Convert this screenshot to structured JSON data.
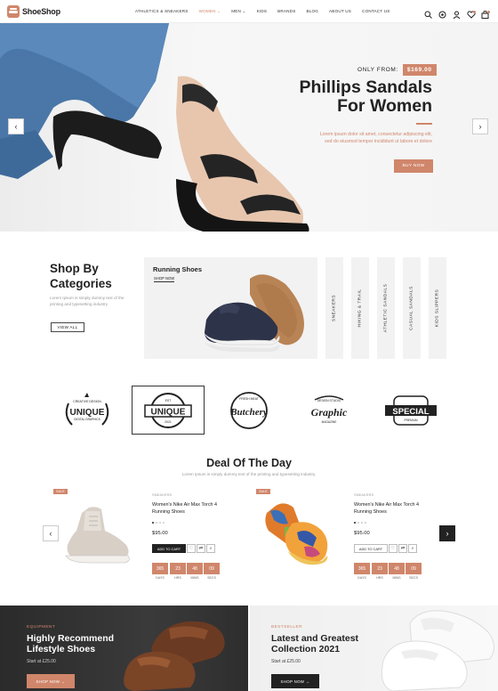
{
  "header": {
    "logo_text": "ShoeShop",
    "nav": [
      "ATHLETICS & SNEAKERS",
      "WOMEN ⌄",
      "MEN ⌄",
      "KIDS",
      "BRANDS",
      "BLOG",
      "ABOUT US",
      "CONTACT US"
    ],
    "active_nav": "WOMEN ⌄",
    "cart_count": "0",
    "wishlist_count": "0"
  },
  "hero": {
    "only_from": "ONLY FROM:",
    "price": "$169.00",
    "title_line1": "Phillips Sandals",
    "title_line2": "For Women",
    "desc_line1": "Lorem ipsum dolor sit amet, consectetur adipiscing elit,",
    "desc_line2": "sed do eiusmod tempor incididunt ut labore et dolore",
    "button": "BUY NOW",
    "prev": "‹",
    "next": "›"
  },
  "categories": {
    "title_line1": "Shop By",
    "title_line2": "Categories",
    "desc_line1": "Lorem Ipsum is simply dummy text of the",
    "desc_line2": "printing and typesetting industry.",
    "view_all": "VIEW ALL",
    "featured_title": "Running Shoes",
    "featured_link": "SHOP NOW",
    "vertical": [
      "SNEAKERS",
      "HIKING & TRAIL",
      "ATHLETIC SANDALS",
      "CASUAL SANDALS",
      "KIDS SLIPPERS"
    ]
  },
  "brands": {
    "items": [
      {
        "name": "UNIQUE",
        "sub": "CREATIVE DESIGN",
        "sub2": "DIGITAL GRAPHICS"
      },
      {
        "name": "UNIQUE",
        "sub": "EST",
        "sub2": "2021"
      },
      {
        "name": "Butchery",
        "sub": "FRESH MEAT",
        "sub2": ""
      },
      {
        "name": "Graphic",
        "sub": "DESIGN STUDIO",
        "sub2": "MAGAZINE"
      },
      {
        "name": "SPECIAL",
        "sub": "PREMIUM",
        "sub2": ""
      }
    ]
  },
  "deal": {
    "title": "Deal Of The Day",
    "subtitle": "Lorem Ipsum is simply dummy text of the printing and typesetting industry.",
    "products": [
      {
        "badge": "SALE",
        "category": "SNEAKERS",
        "name_line1": "Women's Nike Air Max Torch 4",
        "name_line2": "Running Shoes",
        "price": "$95.00",
        "add_to_cart": "ADD TO CART",
        "countdown": [
          {
            "n": "365",
            "l": "DAYS"
          },
          {
            "n": "23",
            "l": "HRS"
          },
          {
            "n": "48",
            "l": "MINS"
          },
          {
            "n": "09",
            "l": "SECS"
          }
        ]
      },
      {
        "badge": "SALE",
        "category": "SNEAKERS",
        "name_line1": "Women's Nike Air Max Torch 4",
        "name_line2": "Running Shoes",
        "price": "$95.00",
        "add_to_cart": "ADD TO CART",
        "countdown": [
          {
            "n": "365",
            "l": "DAYS"
          },
          {
            "n": "23",
            "l": "HRS"
          },
          {
            "n": "48",
            "l": "MINS"
          },
          {
            "n": "09",
            "l": "SECS"
          }
        ]
      }
    ]
  },
  "banners": [
    {
      "tag": "EQUIPMENT",
      "title_line1": "Highly Recommend",
      "title_line2": "Lifestyle Shoes",
      "price": "Start at £25.00",
      "button": "SHOP NOW  →"
    },
    {
      "tag": "BESTSELLER",
      "title_line1": "Latest and Greatest",
      "title_line2": "Collection 2021",
      "price": "Start at £25.00",
      "button": "SHOP NOW  →"
    }
  ],
  "colors": {
    "accent": "#d0866b",
    "dark": "#222222"
  }
}
